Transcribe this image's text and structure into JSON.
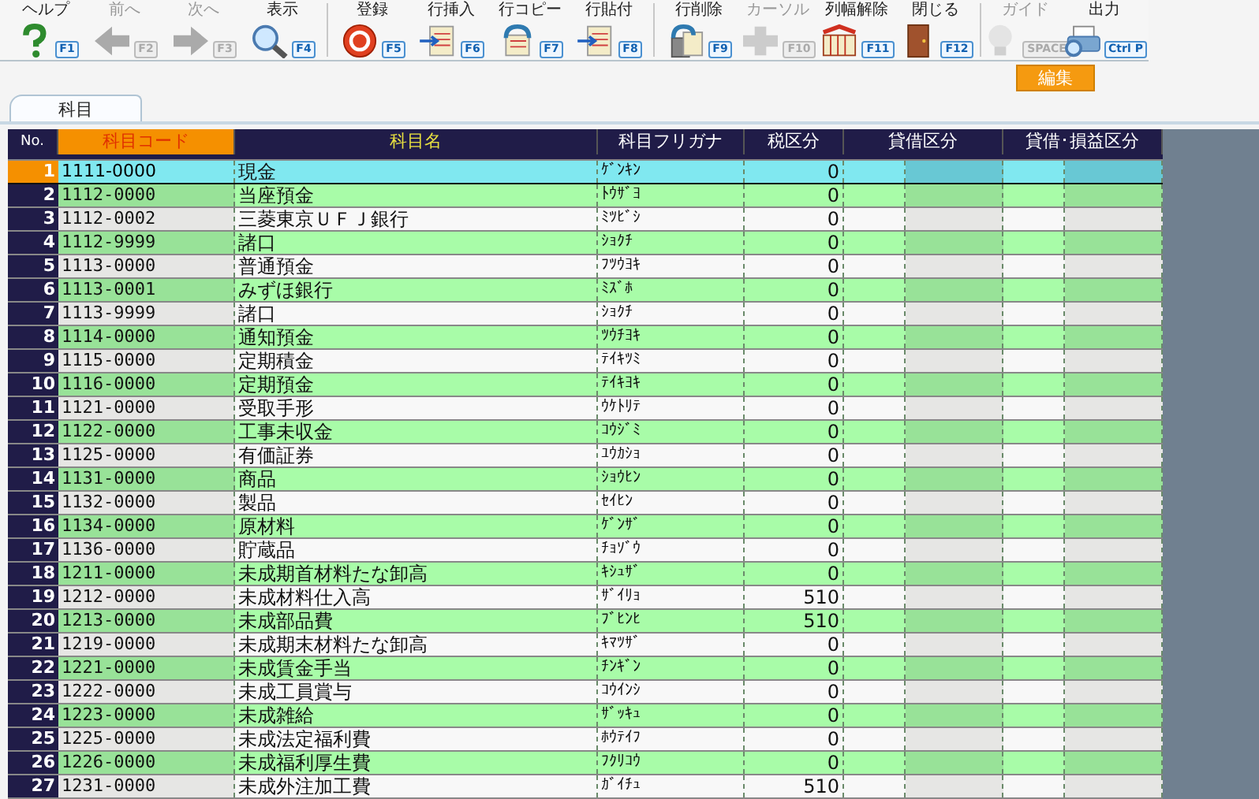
{
  "toolbar": [
    {
      "label": "ヘルプ",
      "key": "F1",
      "disabled": false
    },
    {
      "label": "前へ",
      "key": "F2",
      "disabled": true
    },
    {
      "label": "次へ",
      "key": "F3",
      "disabled": true
    },
    {
      "label": "表示",
      "key": "F4",
      "disabled": false
    },
    {
      "label": "登録",
      "key": "F5",
      "disabled": false
    },
    {
      "label": "行挿入",
      "key": "F6",
      "disabled": false
    },
    {
      "label": "行コピー",
      "key": "F7",
      "disabled": false
    },
    {
      "label": "行貼付",
      "key": "F8",
      "disabled": false
    },
    {
      "label": "行削除",
      "key": "F9",
      "disabled": false
    },
    {
      "label": "カーソル",
      "key": "F10",
      "disabled": true
    },
    {
      "label": "列幅解除",
      "key": "F11",
      "disabled": false
    },
    {
      "label": "閉じる",
      "key": "F12",
      "disabled": false
    },
    {
      "label": "ガイド",
      "key": "SPACE",
      "disabled": true
    },
    {
      "label": "出力",
      "key": "Ctrl P",
      "disabled": false
    }
  ],
  "mode_button": "編集",
  "tabs": [
    {
      "label": "科目",
      "selected": true
    }
  ],
  "table": {
    "columns": [
      {
        "label": "No.",
        "selected": false
      },
      {
        "label": "科目コード",
        "selected": true
      },
      {
        "label": "科目名",
        "selected": false
      },
      {
        "label": "科目フリガナ",
        "selected": false
      },
      {
        "label": "税区分",
        "selected": false
      },
      {
        "label": "貸借区分",
        "selected": false
      },
      {
        "label": "貸借･損益区分",
        "selected": false
      }
    ],
    "rows": [
      {
        "no": "1",
        "code": "1111-0000",
        "name": "現金",
        "kana": "ｹﾞﾝｷﾝ",
        "tax": "0",
        "selected": true
      },
      {
        "no": "2",
        "code": "1112-0000",
        "name": "当座預金",
        "kana": "ﾄｳｻﾞﾖ",
        "tax": "0",
        "selected": false
      },
      {
        "no": "3",
        "code": "1112-0002",
        "name": "三菱東京ＵＦＪ銀行",
        "kana": "ﾐﾂﾋﾞｼ",
        "tax": "0",
        "selected": false
      },
      {
        "no": "4",
        "code": "1112-9999",
        "name": "諸口",
        "kana": "ｼｮｸﾁ",
        "tax": "0",
        "selected": false
      },
      {
        "no": "5",
        "code": "1113-0000",
        "name": "普通預金",
        "kana": "ﾌﾂｳﾖｷ",
        "tax": "0",
        "selected": false
      },
      {
        "no": "6",
        "code": "1113-0001",
        "name": "みずほ銀行",
        "kana": "ﾐｽﾞﾎ",
        "tax": "0",
        "selected": false
      },
      {
        "no": "7",
        "code": "1113-9999",
        "name": "諸口",
        "kana": "ｼｮｸﾁ",
        "tax": "0",
        "selected": false
      },
      {
        "no": "8",
        "code": "1114-0000",
        "name": "通知預金",
        "kana": "ﾂｳﾁﾖｷ",
        "tax": "0",
        "selected": false
      },
      {
        "no": "9",
        "code": "1115-0000",
        "name": "定期積金",
        "kana": "ﾃｲｷﾂﾐ",
        "tax": "0",
        "selected": false
      },
      {
        "no": "10",
        "code": "1116-0000",
        "name": "定期預金",
        "kana": "ﾃｲｷﾖｷ",
        "tax": "0",
        "selected": false
      },
      {
        "no": "11",
        "code": "1121-0000",
        "name": "受取手形",
        "kana": "ｳｹﾄﾘﾃ",
        "tax": "0",
        "selected": false
      },
      {
        "no": "12",
        "code": "1122-0000",
        "name": "工事未収金",
        "kana": "ｺｳｼﾞﾐ",
        "tax": "0",
        "selected": false
      },
      {
        "no": "13",
        "code": "1125-0000",
        "name": "有価証券",
        "kana": "ﾕｳｶｼｮ",
        "tax": "0",
        "selected": false
      },
      {
        "no": "14",
        "code": "1131-0000",
        "name": "商品",
        "kana": "ｼｮｳﾋﾝ",
        "tax": "0",
        "selected": false
      },
      {
        "no": "15",
        "code": "1132-0000",
        "name": "製品",
        "kana": "ｾｲﾋﾝ",
        "tax": "0",
        "selected": false
      },
      {
        "no": "16",
        "code": "1134-0000",
        "name": "原材料",
        "kana": "ｹﾞﾝｻﾞ",
        "tax": "0",
        "selected": false
      },
      {
        "no": "17",
        "code": "1136-0000",
        "name": "貯蔵品",
        "kana": "ﾁｮｿﾞｳ",
        "tax": "0",
        "selected": false
      },
      {
        "no": "18",
        "code": "1211-0000",
        "name": "未成期首材料たな卸高",
        "kana": "ｷｼｭｻﾞ",
        "tax": "0",
        "selected": false
      },
      {
        "no": "19",
        "code": "1212-0000",
        "name": "未成材料仕入高",
        "kana": "ｻﾞｲﾘｮ",
        "tax": "510",
        "selected": false
      },
      {
        "no": "20",
        "code": "1213-0000",
        "name": "未成部品費",
        "kana": "ﾌﾞﾋﾝﾋ",
        "tax": "510",
        "selected": false
      },
      {
        "no": "21",
        "code": "1219-0000",
        "name": "未成期末材料たな卸高",
        "kana": "ｷﾏﾂｻﾞ",
        "tax": "0",
        "selected": false
      },
      {
        "no": "22",
        "code": "1221-0000",
        "name": "未成賃金手当",
        "kana": "ﾁﾝｷﾞﾝ",
        "tax": "0",
        "selected": false
      },
      {
        "no": "23",
        "code": "1222-0000",
        "name": "未成工員賞与",
        "kana": "ｺｳｲﾝｼ",
        "tax": "0",
        "selected": false
      },
      {
        "no": "24",
        "code": "1223-0000",
        "name": "未成雑給",
        "kana": "ｻﾞｯｷｭ",
        "tax": "0",
        "selected": false
      },
      {
        "no": "25",
        "code": "1225-0000",
        "name": "未成法定福利費",
        "kana": "ﾎｳﾃｲﾌ",
        "tax": "0",
        "selected": false
      },
      {
        "no": "26",
        "code": "1226-0000",
        "name": "未成福利厚生費",
        "kana": "ﾌｸﾘｺｳ",
        "tax": "0",
        "selected": false
      },
      {
        "no": "27",
        "code": "1231-0000",
        "name": "未成外注加工費",
        "kana": "ｶﾞｲﾁｭ",
        "tax": "510",
        "selected": false
      }
    ]
  }
}
